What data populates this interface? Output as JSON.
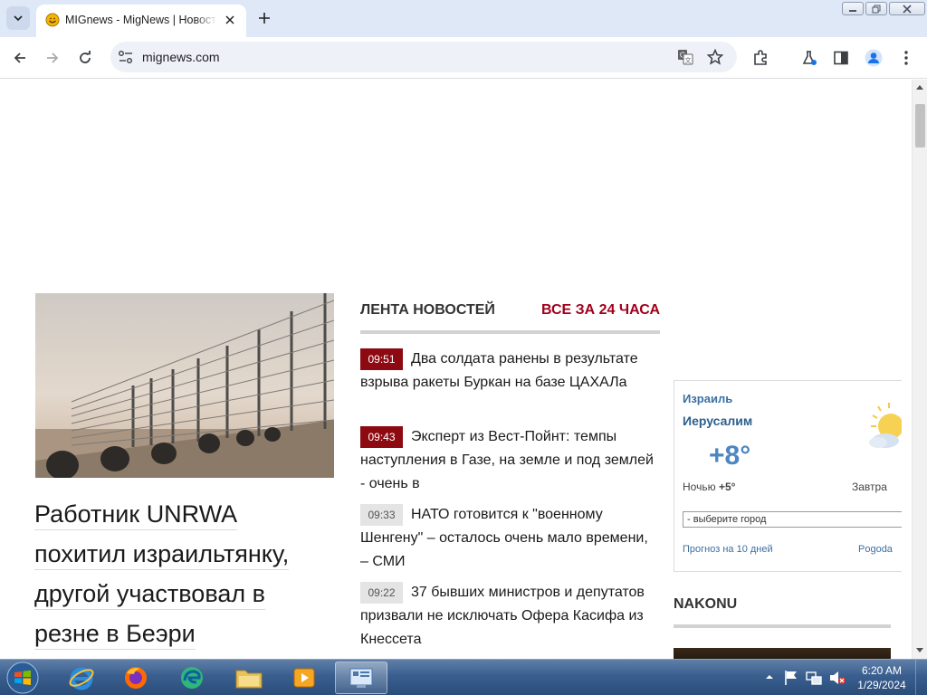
{
  "browser": {
    "tab_title": "MIGnews - MigNews | Новости",
    "url": "mignews.com"
  },
  "page": {
    "hero": {
      "title_lines": [
        "Работник UNRWA",
        "похитил израильтянку,",
        "другой участвовал в",
        "резне в Беэри"
      ]
    },
    "feed": {
      "label": "ЛЕНТА НОВОСТЕЙ",
      "all_label": "ВСЕ ЗА 24 ЧАСА",
      "items": [
        {
          "time": "09:51",
          "text": "Два солдата ранены в результате взрыва ракеты Буркан на базе ЦАХАЛа",
          "highlight": true
        },
        {
          "time": "09:43",
          "text": "Эксперт из Вест-Пойнт: темпы наступления в Газе, на земле и под землей - очень в",
          "highlight": true
        },
        {
          "time": "09:33",
          "text": "НАТО готовится к \"военному Шенгену\" – осталось очень мало времени, – СМИ",
          "highlight": false
        },
        {
          "time": "09:22",
          "text": "37 бывших министров и депутатов призвали не исключать Офера Касифа из Кнессета",
          "highlight": false
        }
      ]
    },
    "weather": {
      "country": "Израиль",
      "city": "Иерусалим",
      "temp": "+8°",
      "night_label": "Ночью",
      "night_temp": "+5°",
      "tomorrow": "Завтра",
      "select_placeholder": "- выберите город",
      "forecast_link": "Прогноз на 10 дней",
      "pogoda_link": "Pogoda"
    },
    "nakonu": {
      "label": "NAKONU"
    }
  },
  "taskbar": {
    "time": "6:20 AM",
    "date": "1/29/2024"
  }
}
